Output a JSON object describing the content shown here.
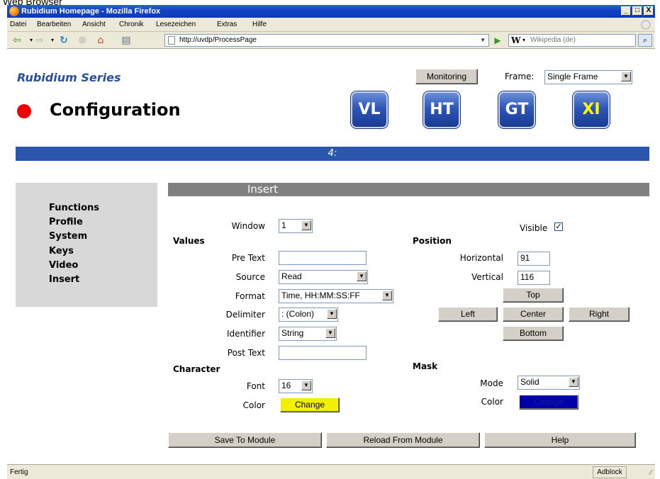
{
  "caption": "Web Browser",
  "window": {
    "title": "Rubidium Homepage - Mozilla Firefox",
    "minimize": "_",
    "maximize": "□",
    "close": "X"
  },
  "menu": {
    "items": [
      "Datei",
      "Bearbeiten",
      "Ansicht",
      "Chronik",
      "Lesezeichen",
      "Extras",
      "Hilfe"
    ]
  },
  "nav": {
    "url": "http://uvdp/ProcessPage",
    "search_engine_logo": "W",
    "search_placeholder": "Wikipedia (de)",
    "icons": [
      "back-icon",
      "forward-icon",
      "reload-icon",
      "stop-icon",
      "home-icon",
      "print-icon",
      "go-icon",
      "search-icon"
    ]
  },
  "header": {
    "brand": "Rubidium Series",
    "title": "Configuration",
    "monitoring_label": "Monitoring",
    "frame_label": "Frame:",
    "frame_value": "Single Frame",
    "modules": [
      "VL",
      "HT",
      "GT",
      "XI"
    ],
    "status_color": "#ee0000"
  },
  "bluebar_text": "4:",
  "sidebar": {
    "items": [
      "Functions",
      "Profile",
      "System",
      "Keys",
      "Video",
      "Insert"
    ]
  },
  "panel": {
    "header": "Insert",
    "window_label": "Window",
    "window_value": "1",
    "visible_label": "Visible",
    "visible_checked": true,
    "check_mark": "✓",
    "values_section": "Values",
    "pre_text_label": "Pre Text",
    "pre_text_value": "",
    "source_label": "Source",
    "source_value": "Read",
    "format_label": "Format",
    "format_value": "Time, HH:MM:SS:FF",
    "delimiter_label": "Delimiter",
    "delimiter_value": ": (Colon)",
    "identifier_label": "Identifier",
    "identifier_value": "String",
    "post_text_label": "Post Text",
    "post_text_value": "",
    "character_section": "Character",
    "font_label": "Font",
    "font_value": "16",
    "color_label": "Color",
    "char_color_button": "Change",
    "char_color": "#f0f000",
    "position_section": "Position",
    "horizontal_label": "Horizontal",
    "horizontal_value": "91",
    "vertical_label": "Vertical",
    "vertical_value": "116",
    "top_button": "Top",
    "left_button": "Left",
    "center_button": "Center",
    "right_button": "Right",
    "bottom_button": "Bottom",
    "mask_section": "Mask",
    "mode_label": "Mode",
    "mode_value": "Solid",
    "mask_color_label": "Color",
    "mask_color_button": "Change",
    "mask_color": "#0000a8"
  },
  "footer": {
    "save": "Save To Module",
    "reload": "Reload From Module",
    "help": "Help"
  },
  "status": {
    "text": "Fertig",
    "adblock": "Adblock"
  }
}
